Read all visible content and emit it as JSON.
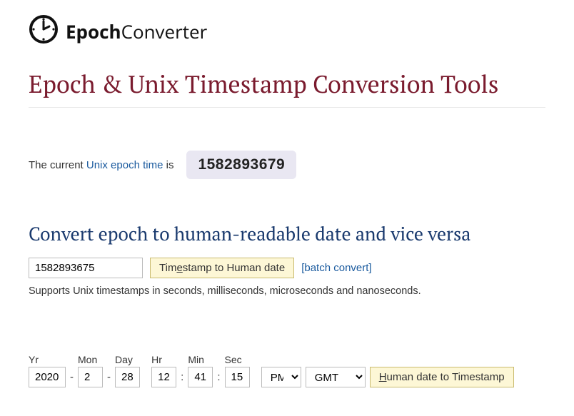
{
  "logo": {
    "part1": "Epoch",
    "part2": "Converter"
  },
  "page_title": "Epoch & Unix Timestamp Conversion Tools",
  "current": {
    "prefix": "The current ",
    "link_text": "Unix epoch time",
    "suffix": " is",
    "value": "1582893679"
  },
  "section1": {
    "heading": "Convert epoch to human-readable date and vice versa",
    "input_value": "1582893675",
    "button_pre": "Tim",
    "button_u": "e",
    "button_post": "stamp to Human date",
    "batch_link": "[batch convert]",
    "support": "Supports Unix timestamps in seconds, milliseconds, microseconds and nanoseconds."
  },
  "date_form": {
    "labels": {
      "yr": "Yr",
      "mon": "Mon",
      "day": "Day",
      "hr": "Hr",
      "min": "Min",
      "sec": "Sec"
    },
    "values": {
      "yr": "2020",
      "mon": "2",
      "day": "28",
      "hr": "12",
      "min": "41",
      "sec": "15"
    },
    "ampm": "PM",
    "tz": "GMT",
    "button_u": "H",
    "button_post": "uman date to Timestamp"
  }
}
